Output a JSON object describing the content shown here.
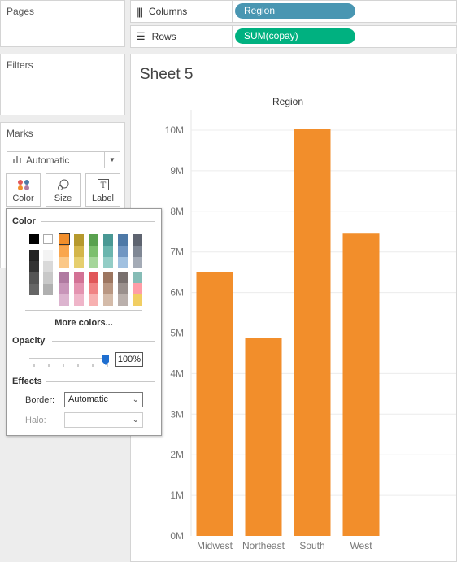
{
  "left_panels": {
    "pages_title": "Pages",
    "filters_title": "Filters",
    "marks_title": "Marks"
  },
  "shelves": {
    "columns_label": "Columns",
    "columns_pill": "Region",
    "rows_label": "Rows",
    "rows_pill": "SUM(copay)"
  },
  "marks": {
    "type_value": "Automatic",
    "buttons": [
      "Color",
      "Size",
      "Label"
    ]
  },
  "color_popup": {
    "color_title": "Color",
    "more_colors": "More colors...",
    "opacity_title": "Opacity",
    "opacity_value": "100%",
    "opacity": 1.0,
    "effects_title": "Effects",
    "border_label": "Border:",
    "border_value": "Automatic",
    "halo_label": "Halo:",
    "halo_value": "",
    "selected_color": "#f28e2b",
    "grays": [
      "#000000",
      "#ffffff"
    ],
    "gray_ramp_dark": [
      "#222222",
      "#333333",
      "#555555",
      "#666666"
    ],
    "gray_ramp_light": [
      "#f3f3f3",
      "#d9d9d9",
      "#c8c8c8",
      "#b0b0b0"
    ],
    "palette_top": [
      [
        "#f28e2b",
        "#f9a64e",
        "#fbc888"
      ],
      [
        "#b6992d",
        "#d4b64a",
        "#e6cf6e"
      ],
      [
        "#59a14f",
        "#7cbf6e",
        "#a5d69a"
      ],
      [
        "#499894",
        "#6ab5ae",
        "#93cdc6"
      ],
      [
        "#4e79a7",
        "#7096c2",
        "#a0c0e0"
      ],
      [
        "#5e6470",
        "#7f8794",
        "#a4abb6"
      ]
    ],
    "palette_bottom": [
      [
        "#b07aa1",
        "#c895b9",
        "#dcb4cf"
      ],
      [
        "#d37295",
        "#e493b0",
        "#efb5c9"
      ],
      [
        "#e15759",
        "#f08384",
        "#f7b0b0"
      ],
      [
        "#9d7660",
        "#b99782",
        "#d4bba9"
      ],
      [
        "#79706e",
        "#9a908d",
        "#bab0ac"
      ],
      [
        "#86bcb6",
        "#ff9da7",
        "#f1ce63"
      ]
    ]
  },
  "sheet": {
    "title": "Sheet 5"
  },
  "chart_data": {
    "type": "bar",
    "title": "Region",
    "categories": [
      "Midwest",
      "Northeast",
      "South",
      "West"
    ],
    "values": [
      6500000,
      4870000,
      10020000,
      7450000
    ],
    "ylim": [
      0,
      10000000
    ],
    "yticks": [
      "0M",
      "1M",
      "2M",
      "3M",
      "4M",
      "5M",
      "6M",
      "7M",
      "8M",
      "9M",
      "10M"
    ],
    "bar_color": "#f28e2b",
    "grid": true
  }
}
